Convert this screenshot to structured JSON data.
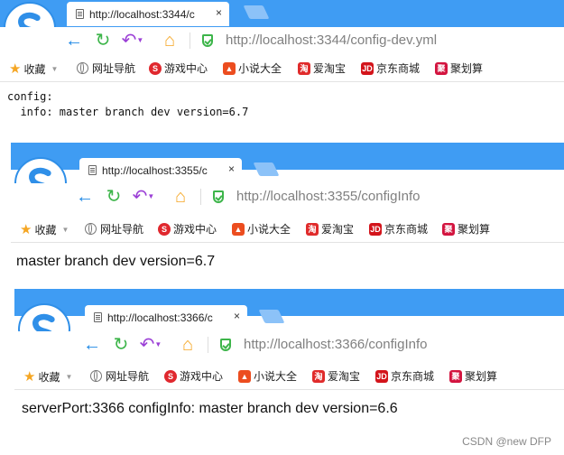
{
  "windows": [
    {
      "tab_title": "http://localhost:3344/c",
      "url_host": "http://localhost:3344",
      "url_path": "/config-dev.yml",
      "content_lines": [
        "config:",
        "  info: master branch dev version=6.7"
      ]
    },
    {
      "tab_title": "http://localhost:3355/c",
      "url_host": "http://localhost:3355",
      "url_path": "/configInfo",
      "content_text": "master branch dev version=6.7"
    },
    {
      "tab_title": "http://localhost:3366/c",
      "url_host": "http://localhost:3366",
      "url_path": "/configInfo",
      "content_text": "serverPort:3366 configInfo: master branch dev version=6.6"
    }
  ],
  "bookmarks": {
    "favorites": "收藏",
    "items": [
      {
        "label": "网址导航",
        "icon": "globe-icon"
      },
      {
        "label": "游戏中心",
        "icon": "game-center-icon",
        "color": "#e0282e"
      },
      {
        "label": "小说大全",
        "icon": "novel-icon",
        "color": "#ec4d1f"
      },
      {
        "label": "爱淘宝",
        "icon": "taobao-icon",
        "color": "#e02b2b"
      },
      {
        "label": "京东商城",
        "icon": "jd-icon",
        "color": "#d3141b"
      },
      {
        "label": "聚划算",
        "icon": "juhuasuan-icon",
        "color": "#d3143f"
      }
    ]
  },
  "tab_close": "×",
  "watermark": "CSDN @new DFP",
  "colors": {
    "titlebar": "#3f9cf3",
    "back": "#1e88e5",
    "refresh": "#3db54a",
    "undo": "#9b3fd6",
    "home": "#f5a623"
  }
}
